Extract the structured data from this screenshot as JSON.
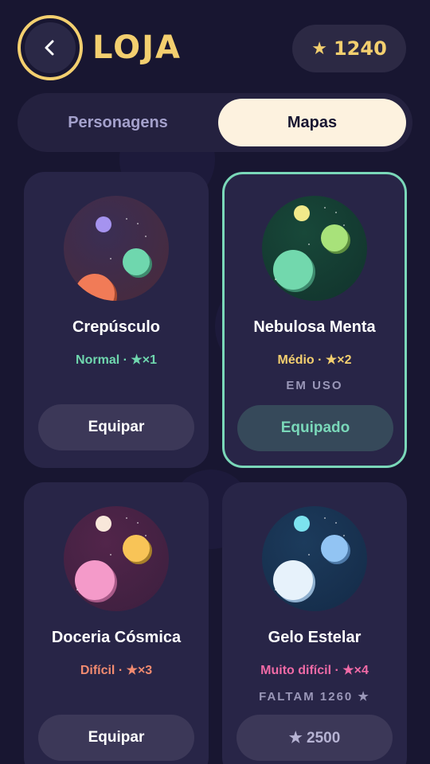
{
  "header": {
    "title": "LOJA",
    "coins": "1240",
    "coin_icon": "star-icon",
    "back_icon": "chevron-left-icon"
  },
  "tabs": [
    {
      "label": "Personagens"
    },
    {
      "label": "Mapas"
    }
  ],
  "active_tab": "Mapas",
  "cards": [
    {
      "name": "Crepúsculo",
      "difficulty": "Normal",
      "stars": "★×1",
      "diff_color": "#6fd7ae",
      "status": "",
      "button": "Equipar"
    },
    {
      "name": "Nebulosa Menta",
      "difficulty": "Médio",
      "stars": "★×2",
      "diff_color": "#f3cf6f",
      "status": "EM USO",
      "button": "Equipado"
    },
    {
      "name": "Doceria Cósmica",
      "difficulty": "Difícil",
      "stars": "★×3",
      "diff_color": "#f28b70",
      "status": "",
      "button": "Equipar"
    },
    {
      "name": "Gelo Estelar",
      "difficulty": "Muito difícil",
      "stars": "★×4",
      "diff_color": "#f06aa6",
      "status": "FALTAM 1260 ★",
      "button": "★ 2500"
    }
  ],
  "colors": {
    "accent": "#f3cf6f",
    "mint": "#7ad8b9",
    "background": "#181631",
    "card": "#282547"
  }
}
